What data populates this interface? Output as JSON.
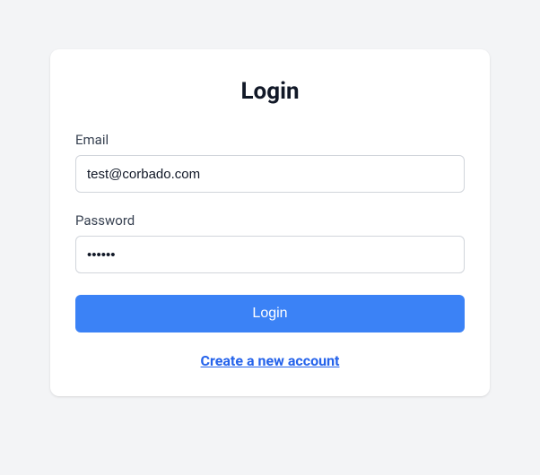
{
  "title": "Login",
  "email": {
    "label": "Email",
    "value": "test@corbado.com"
  },
  "password": {
    "label": "Password",
    "value": "••••••"
  },
  "submit_label": "Login",
  "create_account_label": "Create a new account"
}
